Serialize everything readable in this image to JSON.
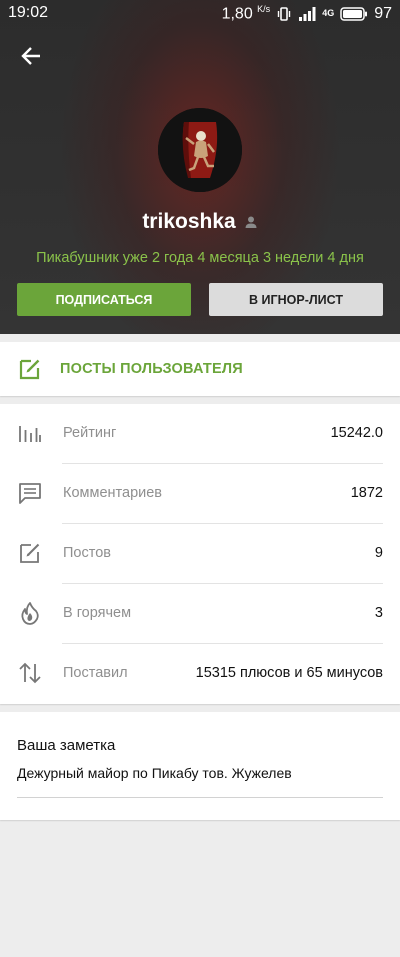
{
  "status_bar": {
    "time": "19:02",
    "speed_value": "1,80",
    "speed_unit": "K/s",
    "network": "4G",
    "battery": "97"
  },
  "profile": {
    "username": "trikoshka",
    "tenure": "Пикабушник уже 2 года 4 месяца 3 недели 4 дня",
    "subscribe_label": "ПОДПИСАТЬСЯ",
    "ignore_label": "В ИГНОР-ЛИСТ"
  },
  "posts_link": {
    "label": "ПОСТЫ ПОЛЬЗОВАТЕЛЯ"
  },
  "stats": [
    {
      "icon": "bar-chart-icon",
      "label": "Рейтинг",
      "value": "15242.0"
    },
    {
      "icon": "comment-icon",
      "label": "Комментариев",
      "value": "1872"
    },
    {
      "icon": "edit-icon",
      "label": "Постов",
      "value": "9"
    },
    {
      "icon": "flame-icon",
      "label": "В горячем",
      "value": "3"
    },
    {
      "icon": "swap-vertical-icon",
      "label": "Поставил",
      "value": "15315 плюсов и 65 минусов"
    }
  ],
  "note": {
    "title": "Ваша заметка",
    "text": "Дежурный майор по Пикабу тов. Жужелев"
  },
  "colors": {
    "accent": "#6ba53a",
    "tenure_text": "#8ac24a",
    "header_bg": "#303030"
  }
}
